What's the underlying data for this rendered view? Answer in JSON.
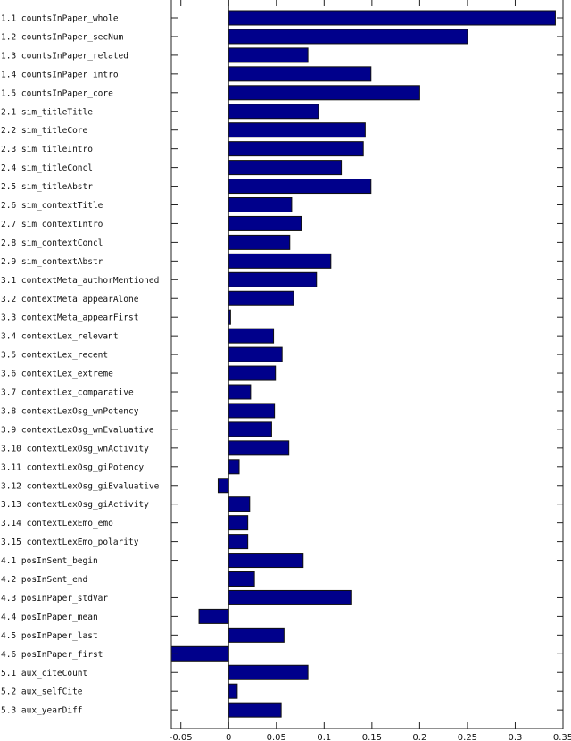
{
  "chart_data": {
    "type": "bar",
    "orientation": "horizontal",
    "title": "",
    "xlabel": "",
    "ylabel": "",
    "xlim": [
      -0.06,
      0.35
    ],
    "bar_color": "#00008b",
    "grid": false,
    "xticks": [
      -0.05,
      0,
      0.05,
      0.1,
      0.15,
      0.2,
      0.25,
      0.3,
      0.35
    ],
    "xtick_labels": [
      "-0.05",
      "0",
      "0.05",
      "0.1",
      "0.15",
      "0.2",
      "0.25",
      "0.3",
      "0.35"
    ],
    "categories": [
      "1.1 countsInPaper_whole",
      "1.2 countsInPaper_secNum",
      "1.3 countsInPaper_related",
      "1.4 countsInPaper_intro",
      "1.5 countsInPaper_core",
      "2.1 sim_titleTitle",
      "2.2 sim_titleCore",
      "2.3 sim_titleIntro",
      "2.4 sim_titleConcl",
      "2.5 sim_titleAbstr",
      "2.6 sim_contextTitle",
      "2.7 sim_contextIntro",
      "2.8 sim_contextConcl",
      "2.9 sim_contextAbstr",
      "3.1 contextMeta_authorMentioned",
      "3.2 contextMeta_appearAlone",
      "3.3 contextMeta_appearFirst",
      "3.4 contextLex_relevant",
      "3.5 contextLex_recent",
      "3.6 contextLex_extreme",
      "3.7 contextLex_comparative",
      "3.8 contextLexOsg_wnPotency",
      "3.9 contextLexOsg_wnEvaluative",
      "3.10 contextLexOsg_wnActivity",
      "3.11 contextLexOsg_giPotency",
      "3.12 contextLexOsg_giEvaluative",
      "3.13 contextLexOsg_giActivity",
      "3.14 contextLexEmo_emo",
      "3.15 contextLexEmo_polarity",
      "4.1 posInSent_begin",
      "4.2 posInSent_end",
      "4.3 posInPaper_stdVar",
      "4.4 posInPaper_mean",
      "4.5 posInPaper_last",
      "4.6 posInPaper_first",
      "5.1 aux_citeCount",
      "5.2 aux_selfCite",
      "5.3 aux_yearDiff"
    ],
    "values": [
      0.342,
      0.25,
      0.083,
      0.149,
      0.2,
      0.094,
      0.143,
      0.141,
      0.118,
      0.149,
      0.066,
      0.076,
      0.064,
      0.107,
      0.092,
      0.068,
      0.002,
      0.047,
      0.056,
      0.049,
      0.023,
      0.048,
      0.045,
      0.063,
      0.011,
      -0.011,
      0.022,
      0.02,
      0.02,
      0.078,
      0.027,
      0.128,
      -0.031,
      0.058,
      -0.06,
      0.083,
      0.009,
      0.055
    ]
  }
}
